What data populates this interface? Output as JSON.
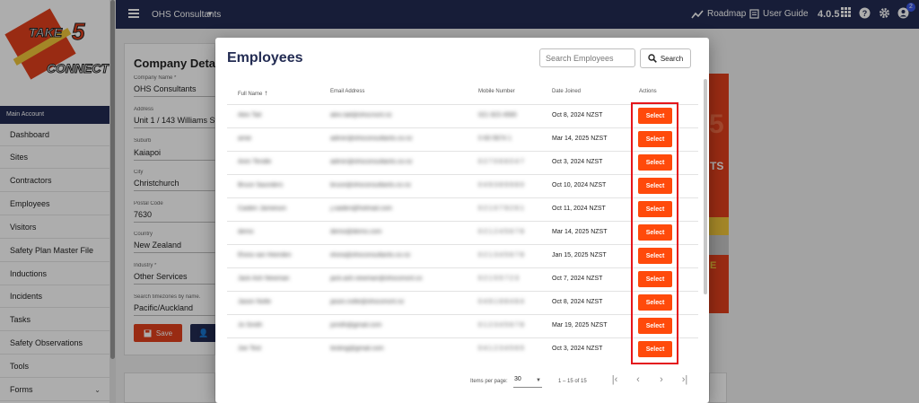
{
  "topbar": {
    "org_name": "OHS Consultants",
    "roadmap_label": "Roadmap",
    "user_guide_label": "User Guide",
    "version": "4.0.5",
    "notification_count": "2"
  },
  "logo": {
    "take": "TAKE",
    "five": "5",
    "connect": "CONNECT"
  },
  "sidebar": {
    "section_label": "Main Account",
    "items": [
      {
        "label": "Dashboard"
      },
      {
        "label": "Sites"
      },
      {
        "label": "Contractors"
      },
      {
        "label": "Employees"
      },
      {
        "label": "Visitors"
      },
      {
        "label": "Safety Plan Master File"
      },
      {
        "label": "Inductions"
      },
      {
        "label": "Incidents"
      },
      {
        "label": "Tasks"
      },
      {
        "label": "Safety Observations"
      },
      {
        "label": "Tools"
      },
      {
        "label": "Forms"
      }
    ]
  },
  "company": {
    "title": "Company Details",
    "fields": [
      {
        "label": "Company Name *",
        "value": "OHS Consultants"
      },
      {
        "label": "Address",
        "value": "Unit 1 / 143 Williams St"
      },
      {
        "label": "Suburb",
        "value": "Kaiapoi"
      },
      {
        "label": "City",
        "value": "Christchurch"
      },
      {
        "label": "Postal Code",
        "value": "7630"
      },
      {
        "label": "Country",
        "value": "New Zealand"
      },
      {
        "label": "Industry *",
        "value": "Other Services"
      },
      {
        "label": "Search timezones by name.",
        "value": "Pacific/Auckland"
      }
    ],
    "save_label": "Save"
  },
  "promo": {
    "text1": "5",
    "text2": "TS",
    "text3": "E"
  },
  "dialog": {
    "title": "Employees",
    "search_placeholder": "Search Employees",
    "search_label": "Search",
    "columns": {
      "name": "Full Name",
      "email": "Email Address",
      "mobile": "Mobile Number",
      "joined": "Date Joined",
      "actions": "Actions"
    },
    "sort_indicator": "↑",
    "select_label": "Select",
    "rows": [
      {
        "name": "Alex Tait",
        "email": "alex.tait@ohscnsnt.nz",
        "mobile": "021 823 4565",
        "joined": "Oct 8, 2024 NZST"
      },
      {
        "name": "amie",
        "email": "admin@ohsconsultants.co.nz",
        "mobile": "0 83 5674 1",
        "joined": "Mar 14, 2025 NZST"
      },
      {
        "name": "Aren Tendle",
        "email": "admin@ohsconsultants.co.nz",
        "mobile": "0 2 7 0 6 6 0 4 7",
        "joined": "Oct 3, 2024 NZST"
      },
      {
        "name": "Bruce Saunders",
        "email": "bruce@ohsconsultants.co.nz",
        "mobile": "0 4 9 3 8 9 9 8 0",
        "joined": "Oct 10, 2024 NZST"
      },
      {
        "name": "Caiden Jamieson",
        "email": "j.caiden@hotmail.com",
        "mobile": "0 2 1 0 7 9 2 6 1",
        "joined": "Oct 11, 2024 NZST"
      },
      {
        "name": "demo",
        "email": "demo@demo.com",
        "mobile": "0 2 1 2 4 5 6 7 8",
        "joined": "Mar 14, 2025 NZST"
      },
      {
        "name": "Elvira van Heerden",
        "email": "elvira@ohsconsultants.co.nz",
        "mobile": "0 2 1 3 4 5 6 7 8",
        "joined": "Jan 15, 2025 NZST"
      },
      {
        "name": "Jack Ash Newman",
        "email": "jack.ash.newman@ohsconsnt.co",
        "mobile": "0 2 1 5 5 7 2 3",
        "joined": "Oct 7, 2024 NZST"
      },
      {
        "name": "Jason Nolte",
        "email": "jason.nolte@ohsconsnt.nz",
        "mobile": "0 4 9 1 8 8 4 8 4",
        "joined": "Oct 8, 2024 NZST"
      },
      {
        "name": "Jo Smith",
        "email": "jsmith@gmail.com",
        "mobile": "0 1 2 3 4 5 6 7 8",
        "joined": "Mar 19, 2025 NZST"
      },
      {
        "name": "Joe Test",
        "email": "testing@gmail.com",
        "mobile": "0 4 1 2 3 4 5 6 5",
        "joined": "Oct 3, 2024 NZST"
      }
    ],
    "paginator": {
      "items_per_page_label": "Items per page:",
      "page_size": "30",
      "range": "1 – 15 of 15"
    }
  }
}
